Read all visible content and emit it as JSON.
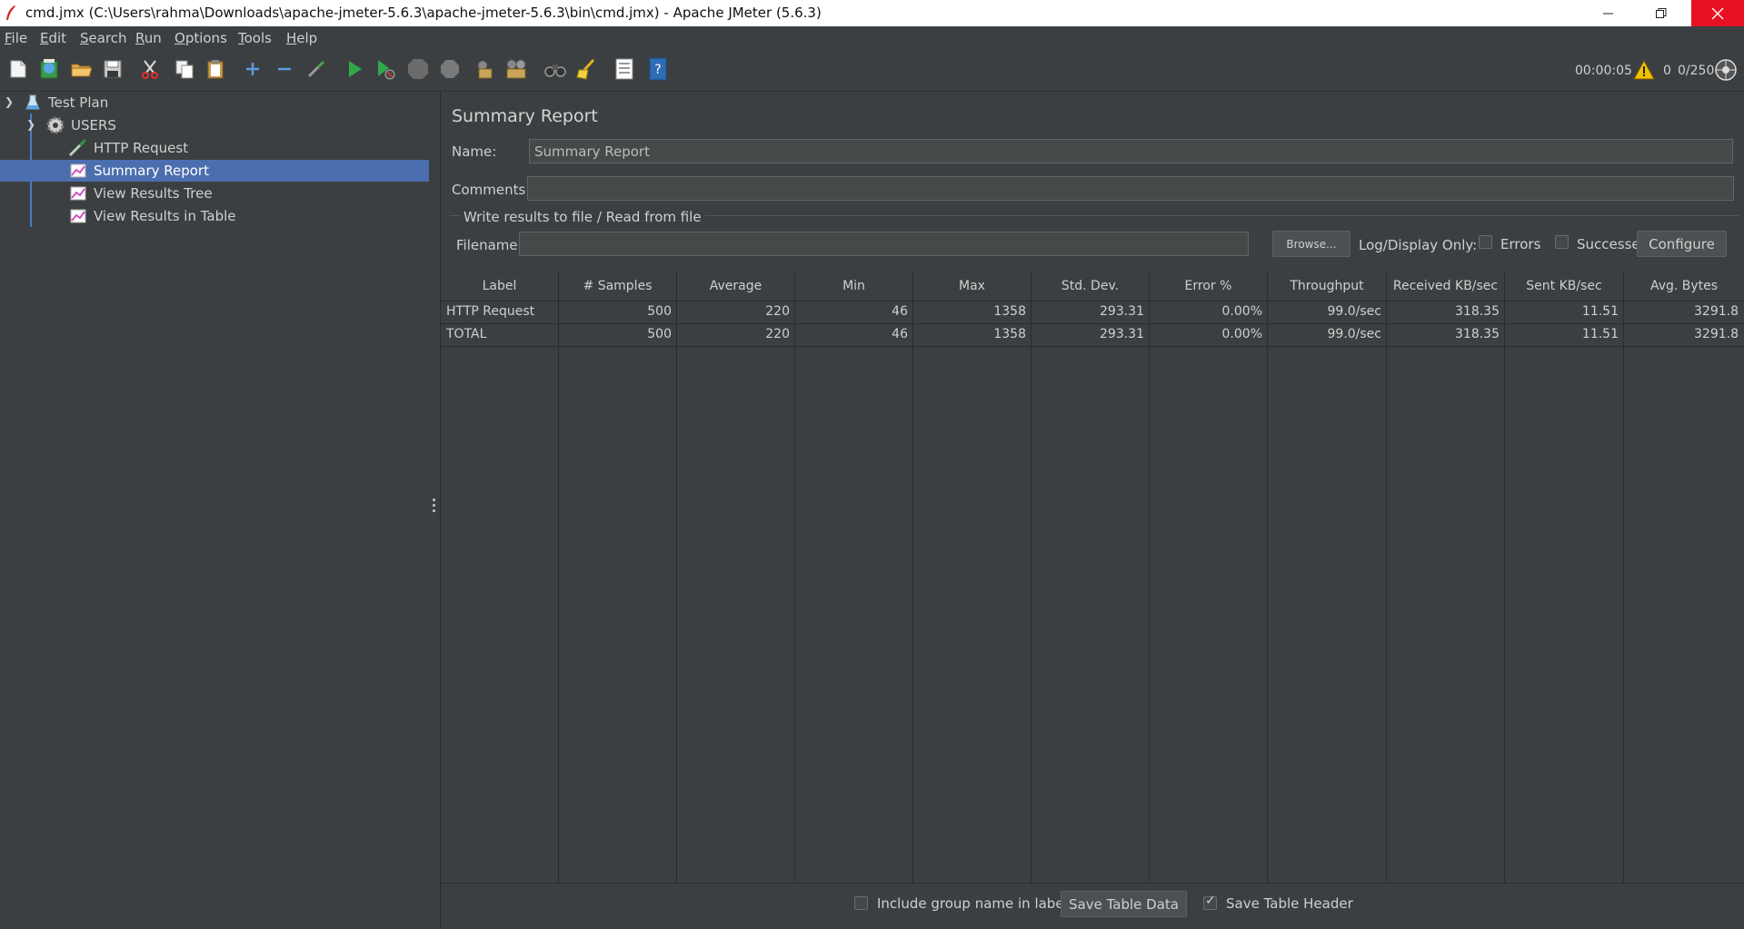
{
  "window": {
    "title": "cmd.jmx (C:\\Users\\rahma\\Downloads\\apache-jmeter-5.6.3\\apache-jmeter-5.6.3\\bin\\cmd.jmx) - Apache JMeter (5.6.3)"
  },
  "menu": {
    "items": [
      {
        "first": "F",
        "rest": "ile"
      },
      {
        "first": "E",
        "rest": "dit"
      },
      {
        "first": "S",
        "rest": "earch"
      },
      {
        "first": "R",
        "rest": "un"
      },
      {
        "first": "O",
        "rest": "ptions"
      },
      {
        "first": "T",
        "rest": "ools"
      },
      {
        "first": "H",
        "rest": "elp"
      }
    ]
  },
  "toolbar": {
    "timer": "00:00:05",
    "error_count": "0",
    "threads": "0/250"
  },
  "tree": {
    "items": [
      {
        "label": "Test Plan",
        "icon": "flask-icon"
      },
      {
        "label": "USERS",
        "icon": "gear-icon"
      },
      {
        "label": "HTTP Request",
        "icon": "pipette-icon"
      },
      {
        "label": "Summary Report",
        "icon": "chart-icon"
      },
      {
        "label": "View Results Tree",
        "icon": "chart-icon"
      },
      {
        "label": "View Results in Table",
        "icon": "chart-icon"
      }
    ]
  },
  "main": {
    "title": "Summary Report",
    "name_label": "Name:",
    "name_value": "Summary Report",
    "comments_label": "Comments:",
    "comments_value": "",
    "file_group_title": "Write results to file / Read from file",
    "filename_label": "Filename",
    "filename_value": "",
    "browse_label": "Browse...",
    "log_display_label": "Log/Display Only:",
    "errors_label": "Errors",
    "successes_label": "Successes",
    "configure_label": "Configure"
  },
  "table": {
    "columns": [
      "Label",
      "# Samples",
      "Average",
      "Min",
      "Max",
      "Std. Dev.",
      "Error %",
      "Throughput",
      "Received KB/sec",
      "Sent KB/sec",
      "Avg. Bytes"
    ],
    "rows": [
      [
        "HTTP Request",
        "500",
        "220",
        "46",
        "1358",
        "293.31",
        "0.00%",
        "99.0/sec",
        "318.35",
        "11.51",
        "3291.8"
      ],
      [
        "TOTAL",
        "500",
        "220",
        "46",
        "1358",
        "293.31",
        "0.00%",
        "99.0/sec",
        "318.35",
        "11.51",
        "3291.8"
      ]
    ]
  },
  "bottom": {
    "include_group_label": "Include group name in label?",
    "include_group_checked": false,
    "save_table_data_label": "Save Table Data",
    "save_table_header_label": "Save Table Header",
    "save_table_header_checked": true
  },
  "colors": {
    "background": "#3c3f41",
    "selection": "#4b6eaf",
    "close_button": "#e81123"
  }
}
